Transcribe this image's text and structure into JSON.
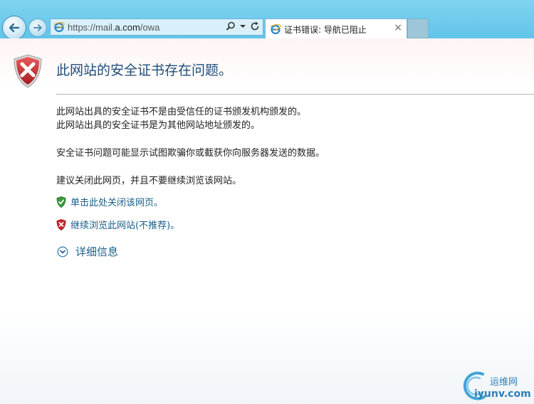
{
  "browser": {
    "address": {
      "scheme": "https://mail.",
      "host": "a.com",
      "path": "/owa"
    },
    "tab": {
      "title": "证书错误: 导航已阻止",
      "close": "×"
    }
  },
  "page": {
    "headline": "此网站的安全证书存在问题。",
    "paragraphs": [
      "此网站出具的安全证书不是由受信任的证书颁发机构颁发的。",
      "此网站出具的安全证书是为其他网站地址颁发的。",
      "安全证书问题可能显示试图欺骗你或截获你向服务器发送的数据。",
      "建议关闭此网页，并且不要继续浏览该网站。"
    ],
    "links": {
      "close_page": "单击此处关闭该网页。",
      "continue": "继续浏览此网站(不推荐)。"
    },
    "details": "详细信息"
  },
  "watermark": {
    "line1": "运维网",
    "line2": "iyunv.com"
  },
  "colors": {
    "chrome": "#62c4ea",
    "headline": "#1f4e79",
    "link": "#1a5f8a",
    "shield_red": "#c8262a",
    "shield_green": "#3a9a3a"
  }
}
